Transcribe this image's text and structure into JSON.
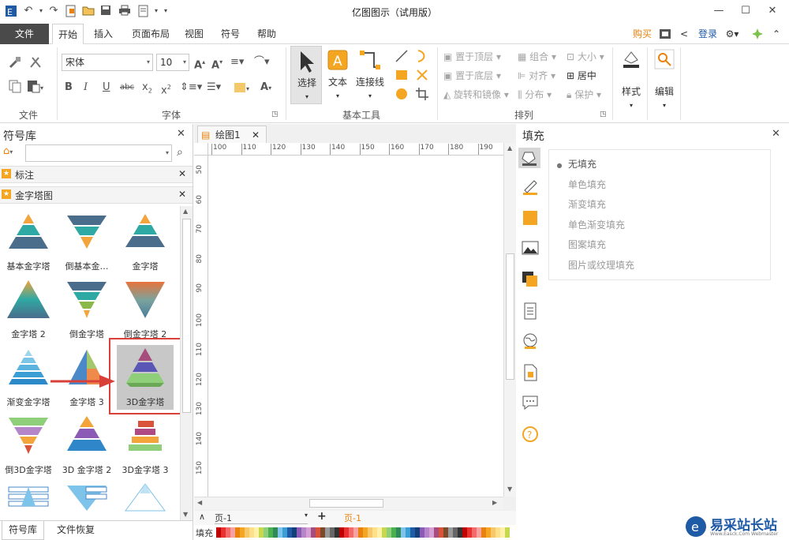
{
  "app_title": "亿图图示（试用版）",
  "menu": {
    "file": "文件",
    "tabs": [
      "开始",
      "插入",
      "页面布局",
      "视图",
      "符号",
      "帮助"
    ],
    "buy": "购买",
    "login": "登录"
  },
  "ribbon": {
    "groups": {
      "file": "文件",
      "font": "字体",
      "basic_tools": "基本工具",
      "arrange": "排列"
    },
    "font_name": "宋体",
    "font_size": "10",
    "tools": {
      "select": "选择",
      "text": "文本",
      "connector": "连接线"
    },
    "arrange": {
      "bring_front": "置于顶层",
      "send_back": "置于底层",
      "rotate_mirror": "旋转和镜像",
      "group": "组合",
      "align": "对齐",
      "distribute": "分布",
      "size": "大小",
      "center": "居中",
      "protect": "保护"
    },
    "style": "样式",
    "edit": "编辑"
  },
  "left_panel": {
    "title": "符号库",
    "search_placeholder": "",
    "categories": [
      "标注",
      "金字塔图"
    ],
    "shapes": [
      "基本金字塔",
      "倒基本金…",
      "金字塔",
      "金字塔 2",
      "倒金字塔",
      "倒金字塔 2",
      "渐变金字塔",
      "金字塔 3",
      "3D金字塔",
      "倒3D金字塔",
      "3D 金字塔 2",
      "3D金字塔 3"
    ],
    "bottom_tabs": [
      "符号库",
      "文件恢复"
    ]
  },
  "canvas": {
    "doc_tab": "绘图1",
    "ruler_h": [
      "100",
      "110",
      "120",
      "130",
      "140",
      "150",
      "160",
      "170",
      "180",
      "190"
    ],
    "ruler_v": [
      "50",
      "60",
      "70",
      "80",
      "90",
      "100",
      "110",
      "120",
      "130",
      "140",
      "150"
    ],
    "page_name": "页-1",
    "page_tab": "页-1",
    "fill_label": "填充"
  },
  "fill_panel": {
    "title": "填充",
    "options": [
      "无填充",
      "单色填充",
      "渐变填充",
      "单色渐变填充",
      "图案填充",
      "图片或纹理填充"
    ],
    "selected": "无填充"
  },
  "watermark": {
    "text": "易采站长站",
    "subtext": "Www.Easck.Com Webmaster"
  },
  "colors": {
    "accent": "#e8820c",
    "file_tab": "#4a4a4a",
    "highlight_box": "#d9403a",
    "arrow": "#d9403a"
  }
}
